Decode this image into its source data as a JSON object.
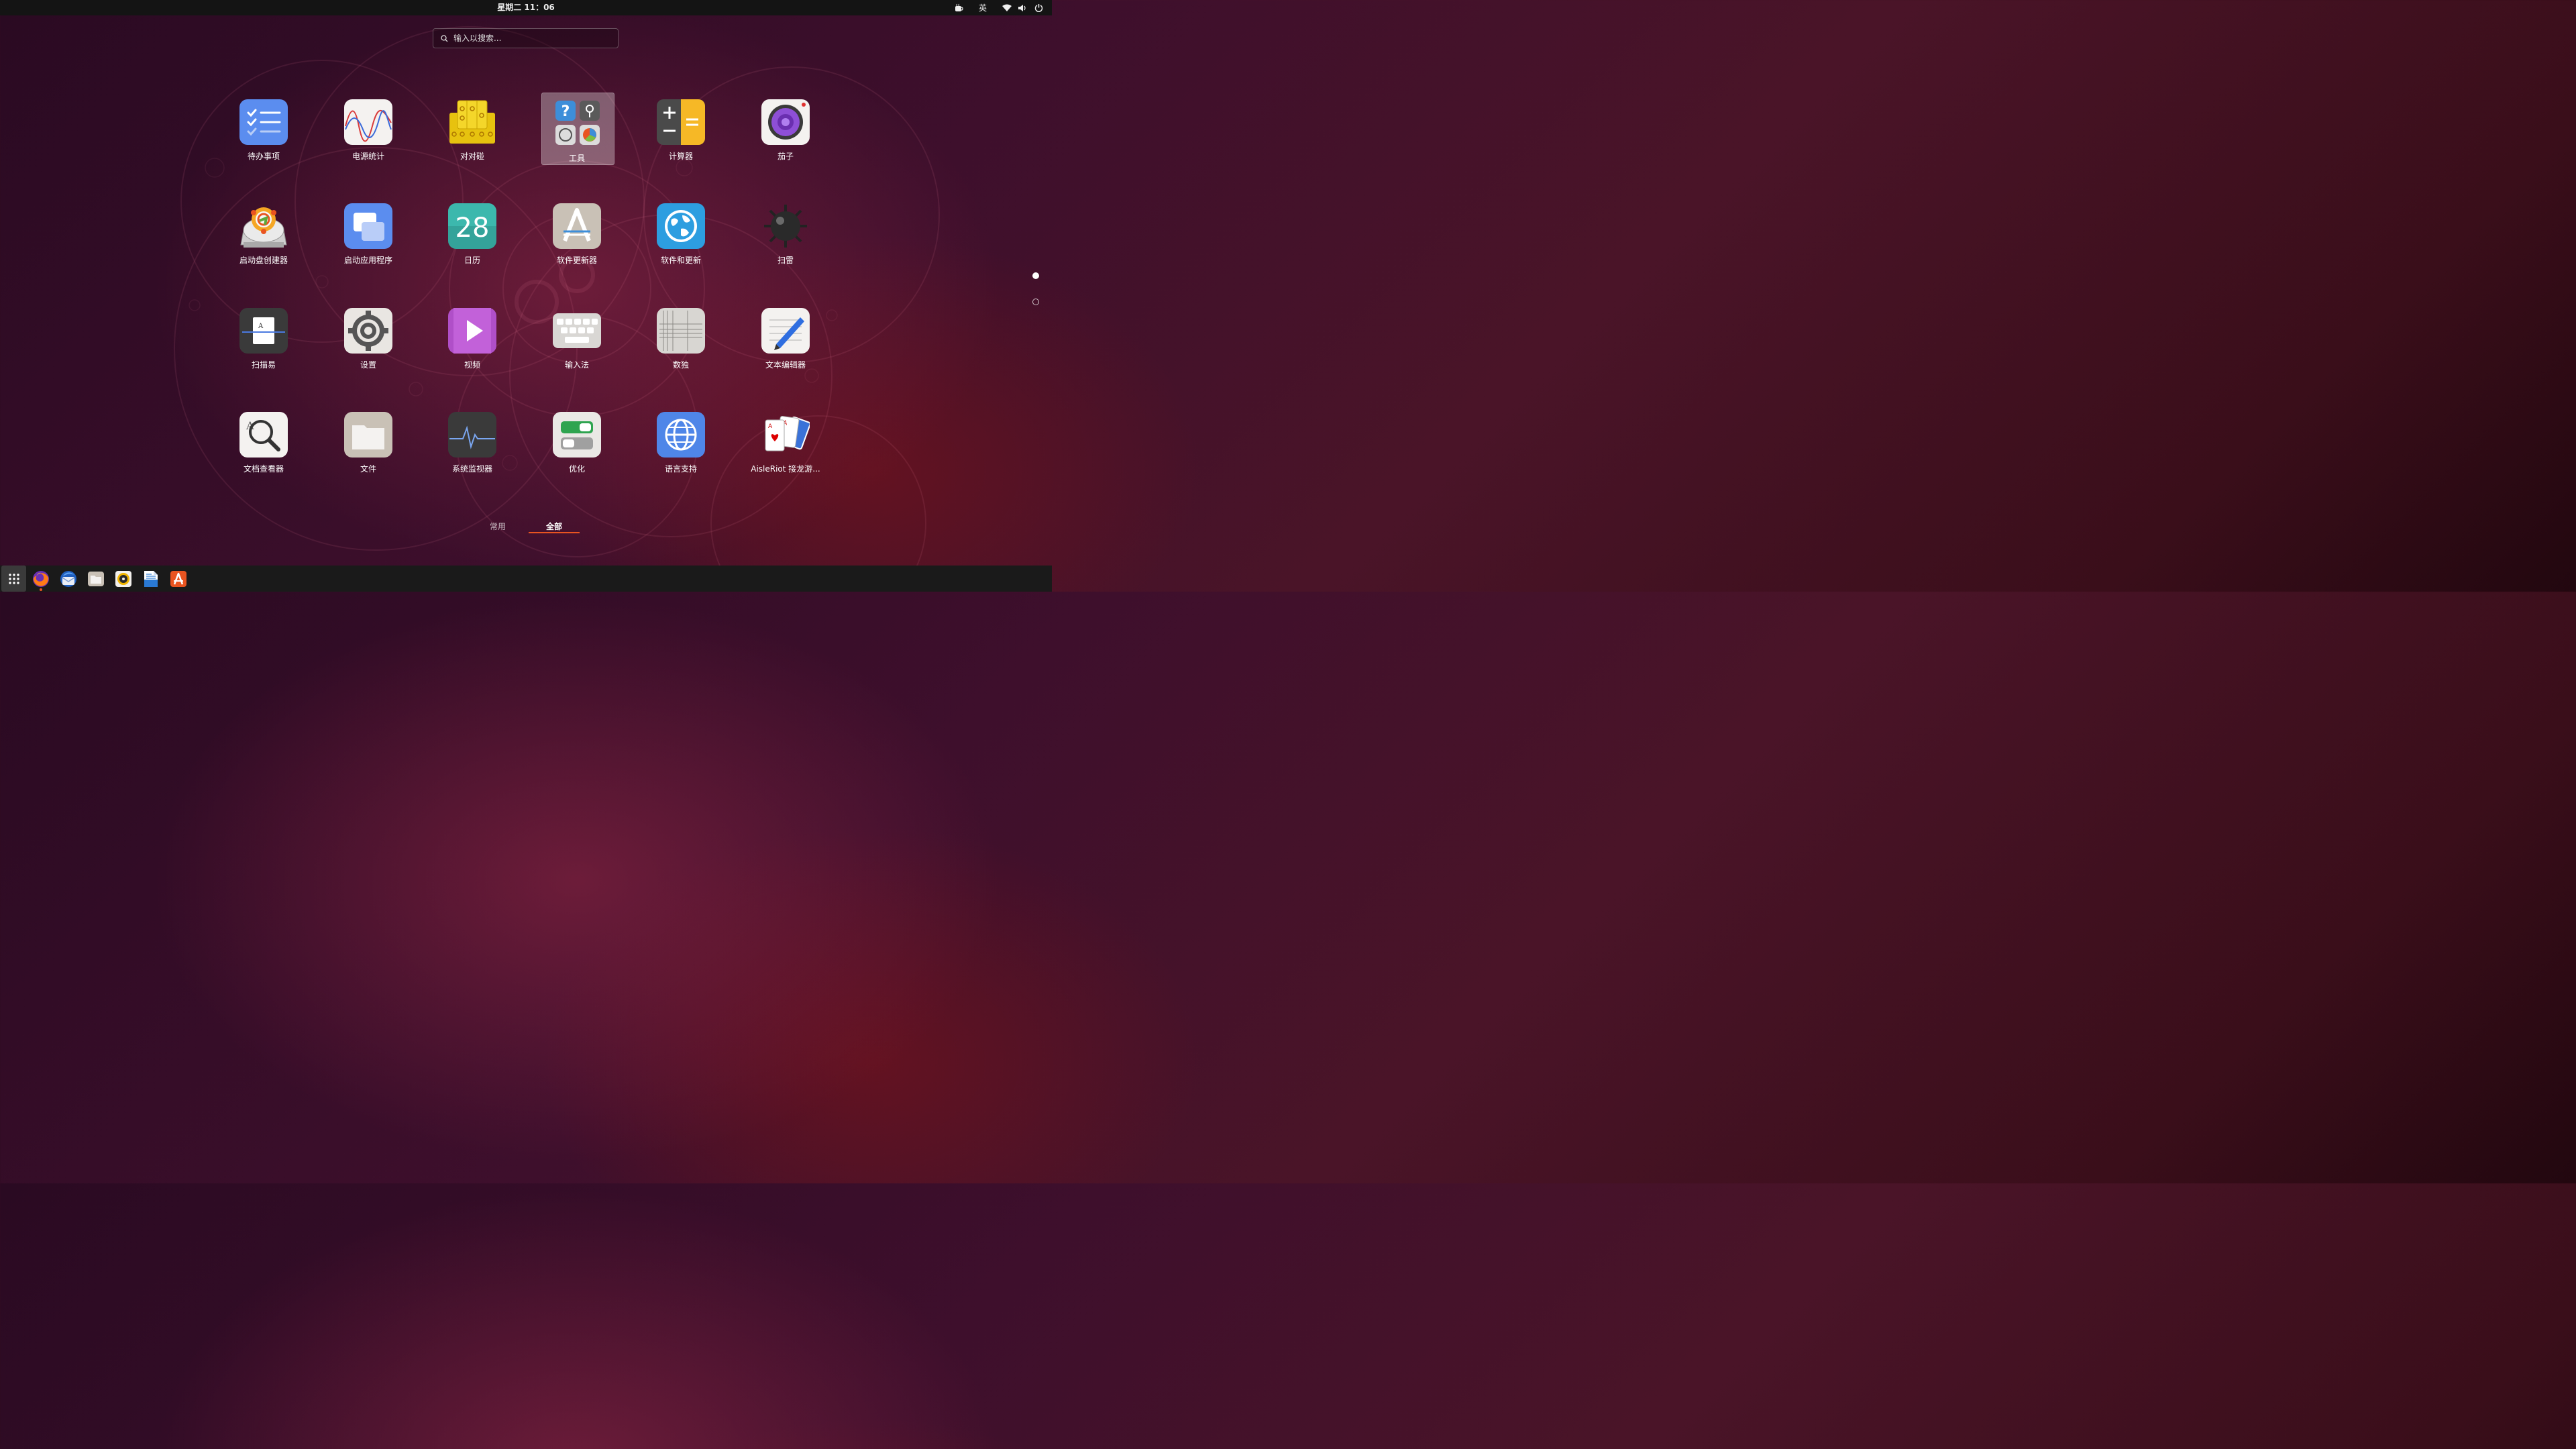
{
  "topbar": {
    "clock": "星期二 11：06",
    "input_method": "英",
    "icons": [
      "weather-icon",
      "wifi-icon",
      "volume-icon",
      "power-icon"
    ]
  },
  "search": {
    "placeholder": "输入以搜索..."
  },
  "apps": [
    {
      "label": "待办事项",
      "icon": "todo-icon"
    },
    {
      "label": "电源统计",
      "icon": "power-statistics-icon"
    },
    {
      "label": "对对碰",
      "icon": "mahjongg-icon"
    },
    {
      "label": "工具",
      "icon": "tools-folder-icon"
    },
    {
      "label": "计算器",
      "icon": "calculator-icon"
    },
    {
      "label": "茄子",
      "icon": "cheese-camera-icon"
    },
    {
      "label": "启动盘创建器",
      "icon": "startup-disk-creator-icon"
    },
    {
      "label": "启动应用程序",
      "icon": "startup-applications-icon"
    },
    {
      "label": "日历",
      "icon": "calendar-icon",
      "badge": "28"
    },
    {
      "label": "软件更新器",
      "icon": "software-updater-icon"
    },
    {
      "label": "软件和更新",
      "icon": "software-properties-icon"
    },
    {
      "label": "扫雷",
      "icon": "mines-icon"
    },
    {
      "label": "扫描易",
      "icon": "simple-scan-icon"
    },
    {
      "label": "设置",
      "icon": "settings-gear-icon"
    },
    {
      "label": "视频",
      "icon": "videos-icon"
    },
    {
      "label": "输入法",
      "icon": "keyboard-input-method-icon"
    },
    {
      "label": "数独",
      "icon": "sudoku-icon"
    },
    {
      "label": "文本编辑器",
      "icon": "text-editor-icon"
    },
    {
      "label": "文档查看器",
      "icon": "document-viewer-icon"
    },
    {
      "label": "文件",
      "icon": "files-folder-icon"
    },
    {
      "label": "系统监视器",
      "icon": "system-monitor-icon"
    },
    {
      "label": "优化",
      "icon": "tweaks-icon"
    },
    {
      "label": "语言支持",
      "icon": "language-support-icon"
    },
    {
      "label": "AisleRiot 接龙游...",
      "icon": "aisleriot-cards-icon"
    }
  ],
  "tabs": {
    "frequent": "常用",
    "all": "全部"
  },
  "colors": {
    "accent": "#e95420",
    "topbar": "#141414",
    "dock": "#1a1a1a"
  },
  "dock": [
    {
      "name": "show-applications-icon"
    },
    {
      "name": "firefox-icon"
    },
    {
      "name": "thunderbird-icon"
    },
    {
      "name": "files-icon"
    },
    {
      "name": "rhythmbox-icon"
    },
    {
      "name": "libreoffice-writer-icon"
    },
    {
      "name": "ubuntu-software-icon"
    }
  ]
}
